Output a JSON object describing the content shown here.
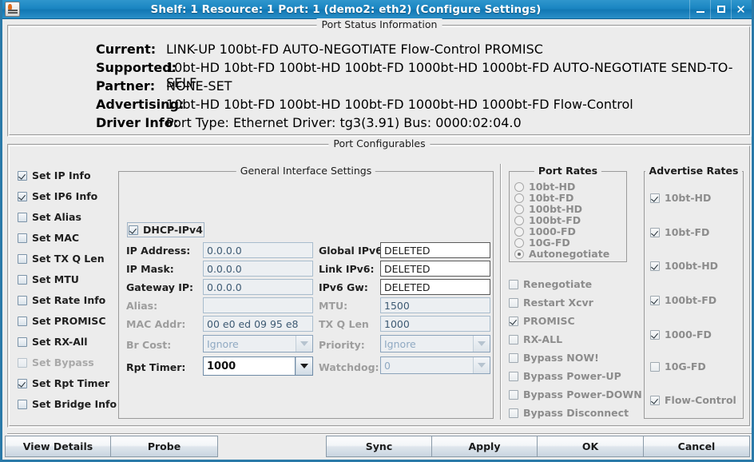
{
  "window": {
    "title": "Shelf: 1  Resource: 1  Port: 1  (demo2: eth2)  (Configure Settings)",
    "icon": "java-app-icon",
    "minimize": "−",
    "maximize": "□",
    "close": "✕",
    "accent": "#1a86c2"
  },
  "status_panel": {
    "title": "Port Status Information",
    "rows": [
      {
        "label": "Current:",
        "value": "LINK-UP 100bt-FD AUTO-NEGOTIATE Flow-Control PROMISC"
      },
      {
        "label": "Supported:",
        "value": "10bt-HD 10bt-FD 100bt-HD 100bt-FD 1000bt-HD 1000bt-FD AUTO-NEGOTIATE SEND-TO-SELF"
      },
      {
        "label": "Partner:",
        "value": "NONE-SET"
      },
      {
        "label": "Advertising:",
        "value": "10bt-HD 10bt-FD 100bt-HD 100bt-FD 1000bt-HD 1000bt-FD Flow-Control"
      },
      {
        "label": "Driver Info:",
        "value": "Port Type: Ethernet   Driver: tg3(3.91)  Bus: 0000:02:04.0"
      }
    ]
  },
  "configurables": {
    "title": "Port Configurables",
    "set_flags": [
      {
        "label": "Set IP Info",
        "checked": true,
        "enabled": true
      },
      {
        "label": "Set IP6 Info",
        "checked": true,
        "enabled": true
      },
      {
        "label": "Set Alias",
        "checked": false,
        "enabled": true
      },
      {
        "label": "Set MAC",
        "checked": false,
        "enabled": true
      },
      {
        "label": "Set TX Q Len",
        "checked": false,
        "enabled": true
      },
      {
        "label": "Set MTU",
        "checked": false,
        "enabled": true
      },
      {
        "label": "Set Rate Info",
        "checked": false,
        "enabled": true
      },
      {
        "label": "Set PROMISC",
        "checked": false,
        "enabled": true
      },
      {
        "label": "Set RX-All",
        "checked": false,
        "enabled": true
      },
      {
        "label": "Set Bypass",
        "checked": false,
        "enabled": false
      },
      {
        "label": "Set Rpt Timer",
        "checked": true,
        "enabled": true
      },
      {
        "label": "Set Bridge Info",
        "checked": false,
        "enabled": true
      }
    ],
    "general": {
      "title": "General Interface Settings",
      "dhcp": {
        "label": "DHCP-IPv4",
        "checked": true
      },
      "left_fields": [
        {
          "label": "IP Address:",
          "value": "0.0.0.0",
          "enabled": true,
          "kind": "text"
        },
        {
          "label": "IP Mask:",
          "value": "0.0.0.0",
          "enabled": true,
          "kind": "text"
        },
        {
          "label": "Gateway IP:",
          "value": "0.0.0.0",
          "enabled": true,
          "kind": "text"
        },
        {
          "label": "Alias:",
          "value": "",
          "enabled": false,
          "kind": "text"
        },
        {
          "label": "MAC Addr:",
          "value": "00 e0 ed 09 95 e8",
          "enabled": false,
          "kind": "text"
        },
        {
          "label": "Br Cost:",
          "value": "Ignore",
          "enabled": false,
          "kind": "combo"
        },
        {
          "label": "Rpt Timer:",
          "value": "1000",
          "enabled": true,
          "kind": "combo"
        }
      ],
      "right_fields": [
        {
          "label": "Global IPv6:",
          "value": "DELETED",
          "enabled": true,
          "kind": "text"
        },
        {
          "label": "Link IPv6:",
          "value": "DELETED",
          "enabled": true,
          "kind": "text"
        },
        {
          "label": "IPv6 Gw:",
          "value": "DELETED",
          "enabled": true,
          "kind": "text"
        },
        {
          "label": "MTU:",
          "value": "1500",
          "enabled": false,
          "kind": "text"
        },
        {
          "label": "TX Q Len",
          "value": "1000",
          "enabled": false,
          "kind": "text"
        },
        {
          "label": "Priority:",
          "value": "Ignore",
          "enabled": false,
          "kind": "combo"
        },
        {
          "label": "Watchdog:",
          "value": "0",
          "enabled": false,
          "kind": "combo"
        }
      ]
    },
    "port_rates": {
      "title": "Port Rates",
      "options": [
        {
          "label": "10bt-HD",
          "selected": false
        },
        {
          "label": "10bt-FD",
          "selected": false
        },
        {
          "label": "100bt-HD",
          "selected": false
        },
        {
          "label": "100bt-FD",
          "selected": false
        },
        {
          "label": "1000-FD",
          "selected": false
        },
        {
          "label": "10G-FD",
          "selected": false
        },
        {
          "label": "Autonegotiate",
          "selected": true
        }
      ]
    },
    "toggles": [
      {
        "label": "Renegotiate",
        "checked": false
      },
      {
        "label": "Restart Xcvr",
        "checked": false
      },
      {
        "label": "PROMISC",
        "checked": true
      },
      {
        "label": "RX-ALL",
        "checked": false
      },
      {
        "label": "Bypass NOW!",
        "checked": false
      },
      {
        "label": "Bypass Power-UP",
        "checked": false
      },
      {
        "label": "Bypass Power-DOWN",
        "checked": false
      },
      {
        "label": "Bypass Disconnect",
        "checked": false
      }
    ],
    "advertise_rates": {
      "title": "Advertise Rates",
      "options": [
        {
          "label": "10bt-HD",
          "checked": true
        },
        {
          "label": "10bt-FD",
          "checked": true
        },
        {
          "label": "100bt-HD",
          "checked": true
        },
        {
          "label": "100bt-FD",
          "checked": true
        },
        {
          "label": "1000-FD",
          "checked": true
        },
        {
          "label": "10G-FD",
          "checked": false
        },
        {
          "label": "Flow-Control",
          "checked": true
        }
      ]
    }
  },
  "buttons": {
    "left": [
      {
        "label": "View Details"
      },
      {
        "label": "Probe"
      }
    ],
    "right": [
      {
        "label": "Sync"
      },
      {
        "label": "Apply"
      },
      {
        "label": "OK"
      },
      {
        "label": "Cancel"
      }
    ]
  }
}
